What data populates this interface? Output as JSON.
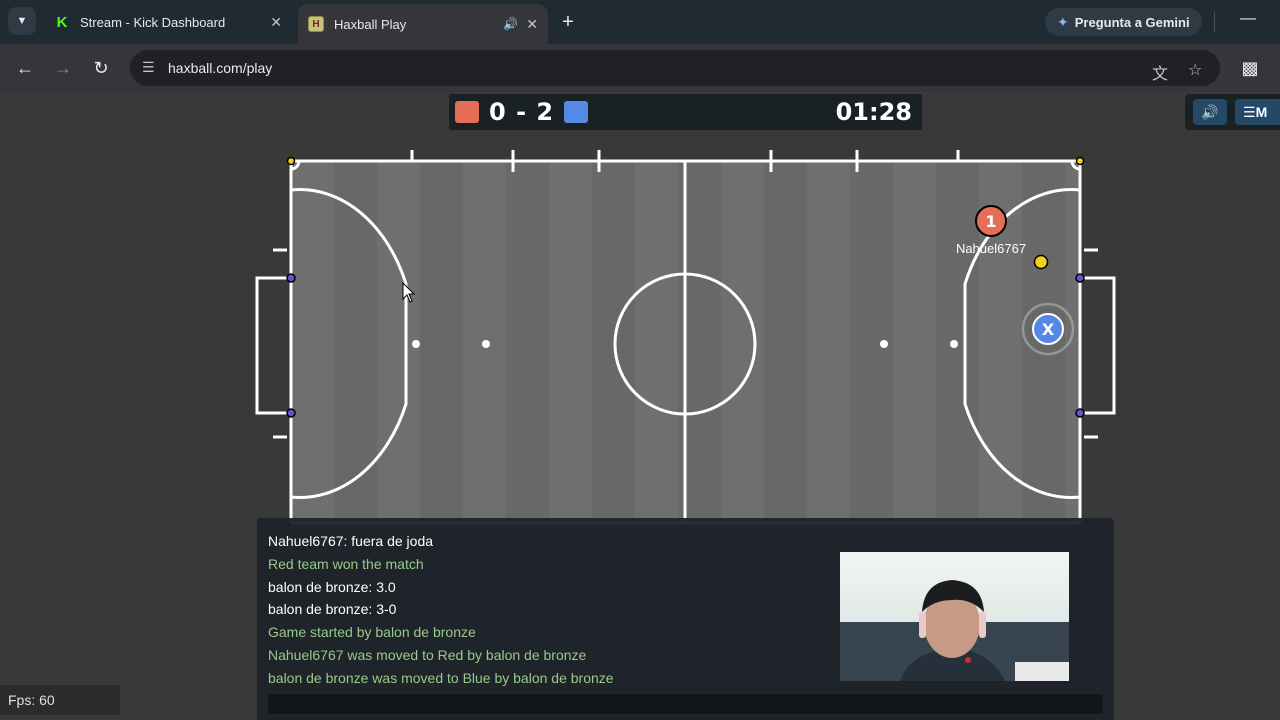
{
  "browser": {
    "tabs": [
      {
        "title": "Stream - Kick Dashboard",
        "favicon": "kick-icon",
        "active": false
      },
      {
        "title": "Haxball Play",
        "favicon": "haxball-icon",
        "active": true,
        "audio": true
      }
    ],
    "new_tab_symbol": "+",
    "gemini_label": "Pregunta a Gemini",
    "url": "haxball.com/play"
  },
  "game": {
    "red_score": "0",
    "separator": "-",
    "blue_score": "2",
    "timer": "01:28",
    "menu_label": "M",
    "colors": {
      "red": "#e56e56",
      "blue": "#5689e5",
      "ball": "#f1d21c",
      "field": "#6b6b6b",
      "lines": "#ffffff"
    },
    "players": [
      {
        "team": "red",
        "label": "1",
        "name": "Nahuel6767"
      },
      {
        "team": "blue",
        "label": "X",
        "name": ""
      }
    ]
  },
  "chat": {
    "messages": [
      {
        "text": "Nahuel6767: fuera de joda",
        "kind": "chat"
      },
      {
        "text": "Red team won the match",
        "kind": "notice"
      },
      {
        "text": "balon de bronze: 3.0",
        "kind": "chat"
      },
      {
        "text": "balon de bronze: 3-0",
        "kind": "chat"
      },
      {
        "text": "Game started by balon de bronze",
        "kind": "notice"
      },
      {
        "text": "Nahuel6767 was moved to Red by balon de bronze",
        "kind": "notice"
      },
      {
        "text": "balon de bronze was moved to Blue by balon de bronze",
        "kind": "notice"
      }
    ],
    "input_value": ""
  },
  "fps_label": "Fps: 60"
}
